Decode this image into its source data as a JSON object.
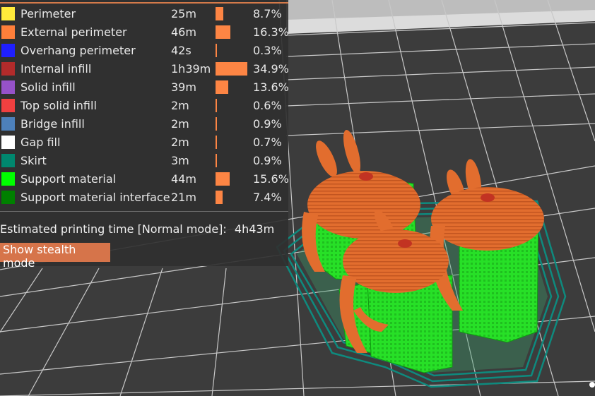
{
  "legend": {
    "rows": [
      {
        "label": "Perimeter",
        "time": "25m",
        "percent": "8.7%",
        "fraction": 0.087,
        "color": "#ffeb3b"
      },
      {
        "label": "External perimeter",
        "time": "46m",
        "percent": "16.3%",
        "fraction": 0.163,
        "color": "#ff7f3a"
      },
      {
        "label": "Overhang perimeter",
        "time": "42s",
        "percent": "0.3%",
        "fraction": 0.003,
        "color": "#1f1fff"
      },
      {
        "label": "Internal infill",
        "time": "1h39m",
        "percent": "34.9%",
        "fraction": 0.349,
        "color": "#b22b2b"
      },
      {
        "label": "Solid infill",
        "time": "39m",
        "percent": "13.6%",
        "fraction": 0.136,
        "color": "#9652c9"
      },
      {
        "label": "Top solid infill",
        "time": "2m",
        "percent": "0.6%",
        "fraction": 0.006,
        "color": "#f04040"
      },
      {
        "label": "Bridge infill",
        "time": "2m",
        "percent": "0.9%",
        "fraction": 0.009,
        "color": "#4d80ba"
      },
      {
        "label": "Gap fill",
        "time": "2m",
        "percent": "0.7%",
        "fraction": 0.007,
        "color": "#ffffff"
      },
      {
        "label": "Skirt",
        "time": "3m",
        "percent": "0.9%",
        "fraction": 0.009,
        "color": "#00876e"
      },
      {
        "label": "Support material",
        "time": "44m",
        "percent": "15.6%",
        "fraction": 0.156,
        "color": "#00ff00"
      },
      {
        "label": "Support material interface",
        "time": "21m",
        "percent": "7.4%",
        "fraction": 0.074,
        "color": "#008000"
      }
    ]
  },
  "estimate": {
    "label": "Estimated printing time [Normal mode]:",
    "value": "4h43m"
  },
  "stealth_button": {
    "label": "Show stealth mode"
  },
  "colors": {
    "accent": "#d6744a",
    "bar": "#fd8544",
    "bunny": "#e06a2c",
    "support": "#22e622",
    "skirt": "#0e8a7e"
  }
}
